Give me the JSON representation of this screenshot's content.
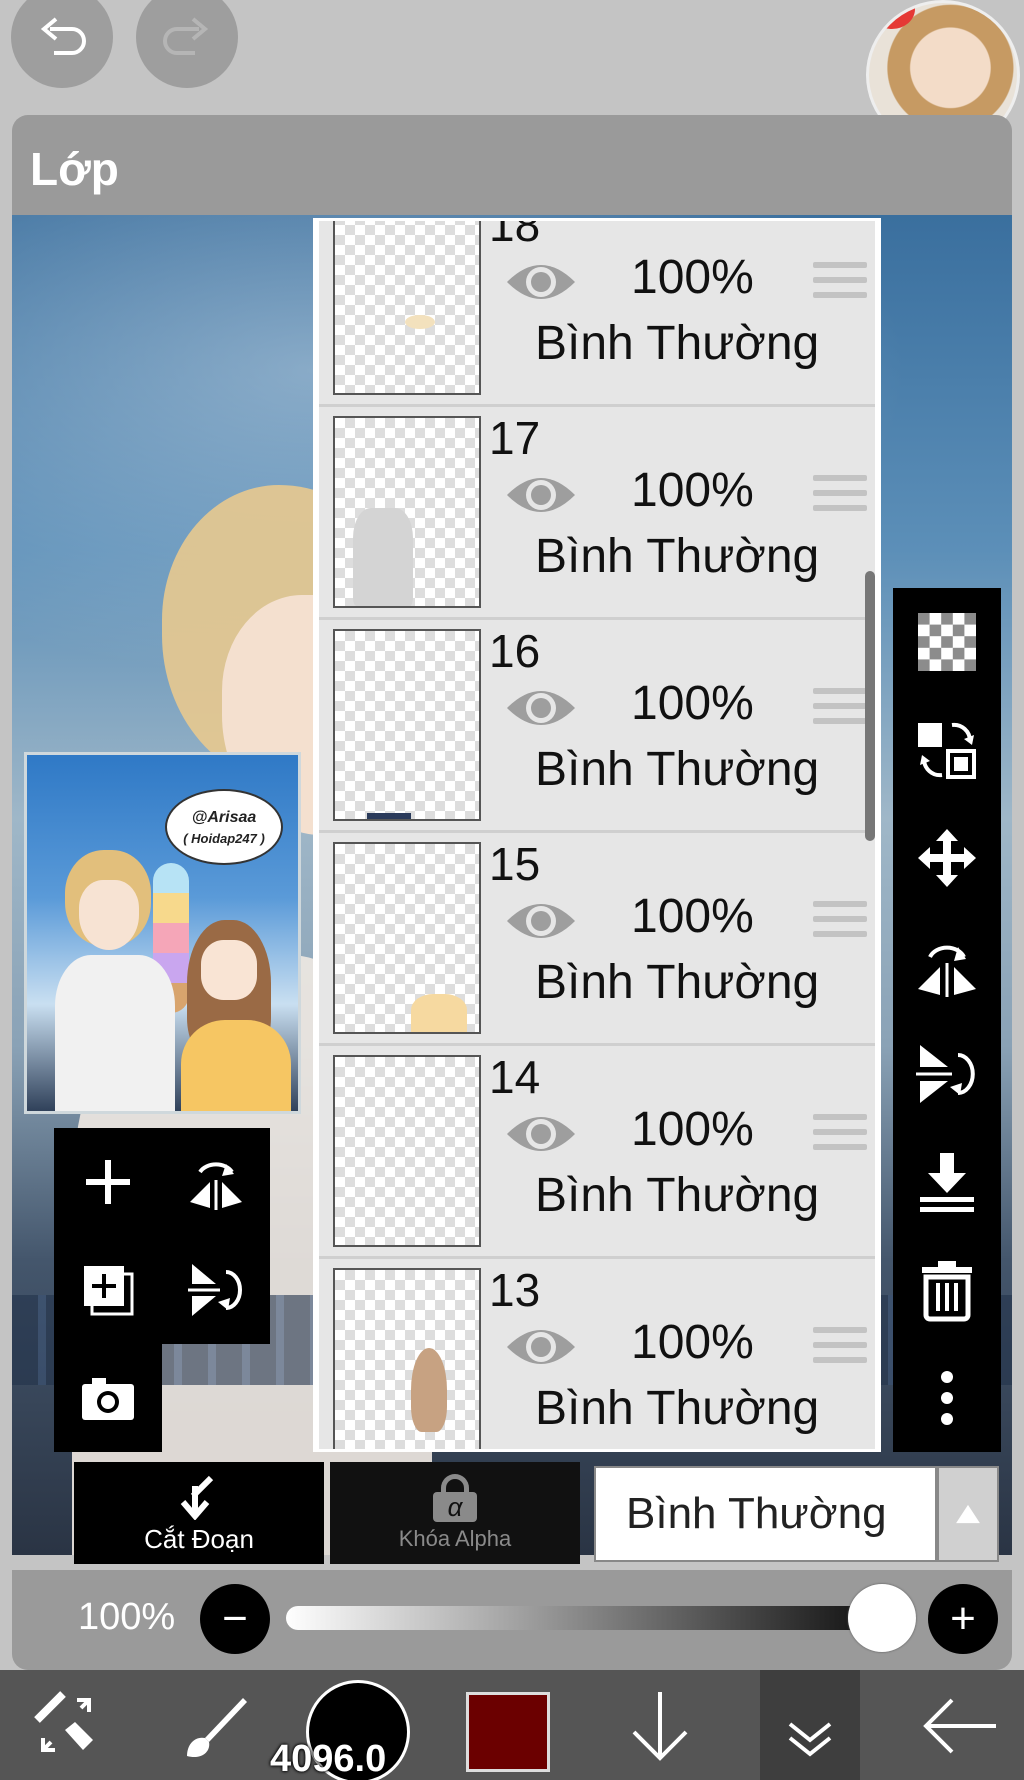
{
  "panel": {
    "title": "Lớp"
  },
  "thumbnail": {
    "bubble_line1": "@Arisaa",
    "bubble_line2": "( Hoidap247 )"
  },
  "layers": [
    {
      "number": "18",
      "opacity": "100%",
      "blend_mode": "Bình Thường"
    },
    {
      "number": "17",
      "opacity": "100%",
      "blend_mode": "Bình Thường"
    },
    {
      "number": "16",
      "opacity": "100%",
      "blend_mode": "Bình Thường"
    },
    {
      "number": "15",
      "opacity": "100%",
      "blend_mode": "Bình Thường"
    },
    {
      "number": "14",
      "opacity": "100%",
      "blend_mode": "Bình Thường"
    },
    {
      "number": "13",
      "opacity": "100%",
      "blend_mode": "Bình Thường"
    }
  ],
  "controls": {
    "clip_label": "Cắt Đoạn",
    "alpha_lock_label": "Khóa Alpha",
    "alpha_symbol": "α",
    "blend_mode_selected": "Bình Thường",
    "opacity_label": "100%",
    "opacity_value": 1.0,
    "minus": "−",
    "plus": "+"
  },
  "bottom_bar": {
    "brush_size": "4096.0",
    "current_color": "#6b0000"
  },
  "icons": {
    "undo": "undo-icon",
    "redo": "redo-icon",
    "add_layer": "plus-icon",
    "flip_h": "flip-horizontal-icon",
    "add_copy": "add-copy-icon",
    "flip_v": "flip-vertical-icon",
    "camera": "camera-icon",
    "transparent": "checker-icon",
    "swap": "swap-layer-icon",
    "move": "move-icon",
    "merge_down": "merge-down-icon",
    "trash": "trash-icon",
    "more": "more-vert-icon",
    "tools": "tools-icon",
    "brush": "brush-icon",
    "arrow_down": "arrow-down-icon",
    "chevrons": "double-chevron-down-icon",
    "back": "back-arrow-icon"
  }
}
